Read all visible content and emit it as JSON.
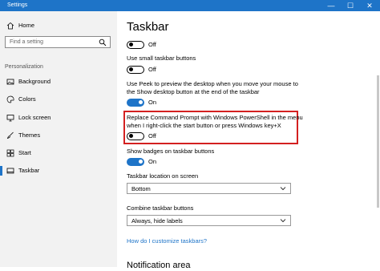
{
  "window": {
    "title": "Settings",
    "minimize": "—",
    "maximize": "☐",
    "close": "✕"
  },
  "sidebar": {
    "home": "Home",
    "search_placeholder": "Find a setting",
    "section": "Personalization",
    "items": [
      {
        "label": "Background",
        "icon": "picture-icon"
      },
      {
        "label": "Colors",
        "icon": "palette-icon"
      },
      {
        "label": "Lock screen",
        "icon": "monitor-icon"
      },
      {
        "label": "Themes",
        "icon": "brush-icon"
      },
      {
        "label": "Start",
        "icon": "start-icon"
      },
      {
        "label": "Taskbar",
        "icon": "taskbar-icon",
        "selected": true
      }
    ]
  },
  "main": {
    "title": "Taskbar",
    "toggle1_state": "Off",
    "small_buttons_label": "Use small taskbar buttons",
    "small_buttons_state": "Off",
    "peek_label_line1": "Use Peek to preview the desktop when you move your mouse to",
    "peek_label_line2": "the Show desktop button at the end of the taskbar",
    "peek_state": "On",
    "powershell_label_line1": "Replace Command Prompt with Windows PowerShell in the menu",
    "powershell_label_line2": "when I right-click the start button or press Windows key+X",
    "powershell_state": "Off",
    "badges_label": "Show badges on taskbar buttons",
    "badges_state": "On",
    "location_label": "Taskbar location on screen",
    "location_value": "Bottom",
    "combine_label": "Combine taskbar buttons",
    "combine_value": "Always, hide labels",
    "help_link": "How do I customize taskbars?",
    "notification_heading": "Notification area"
  },
  "colors": {
    "accent": "#1e74c8",
    "highlight": "#d32020",
    "sidebar_bg": "#f2f2f2"
  }
}
